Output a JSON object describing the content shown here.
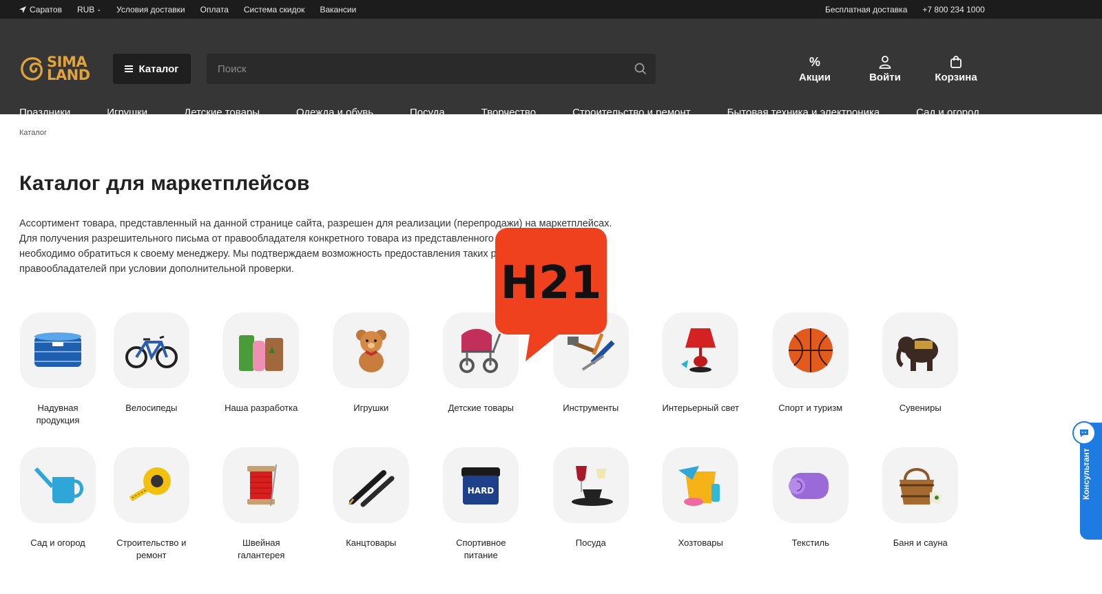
{
  "topbar": {
    "city": "Саратов",
    "currency": "RUB",
    "links": [
      "Условия доставки",
      "Оплата",
      "Система скидок",
      "Вакансии"
    ],
    "free_delivery": "Бесплатная доставка",
    "phone": "+7 800 234 1000"
  },
  "header": {
    "logo_line1": "SIMA",
    "logo_line2": "LAND",
    "catalog_button": "Каталог",
    "search_placeholder": "Поиск",
    "actions": {
      "promo": "Акции",
      "login": "Войти",
      "cart": "Корзина"
    }
  },
  "nav": [
    "Праздники",
    "Игрушки",
    "Детские товары",
    "Одежда и обувь",
    "Посуда",
    "Творчество",
    "Строительство и ремонт",
    "Бытовая техника и электроника",
    "Сад и огород"
  ],
  "breadcrumb": "Каталог",
  "title": "Каталог для маркетплейсов",
  "description": "Ассортимент товара, представленный на данной странице сайта, разрешен для реализации (перепродажи) на маркетплейсах. Для получения разрешительного письма от правообладателя конкретного товара из представленного ассортимента, вам необходимо обратиться к своему менеджеру. Мы подтверждаем возможность предоставления таких разрешений от правообладателей при условии дополнительной проверки.",
  "categories_row1": [
    {
      "name": "Надувная продукция",
      "icon": "pool-icon"
    },
    {
      "name": "Велосипеды",
      "icon": "bicycle-icon"
    },
    {
      "name": "Наша разработка",
      "icon": "products-icon"
    },
    {
      "name": "Игрушки",
      "icon": "teddy-bear-icon"
    },
    {
      "name": "Детские товары",
      "icon": "stroller-icon"
    },
    {
      "name": "Инструменты",
      "icon": "tools-icon"
    },
    {
      "name": "Интерьерный свет",
      "icon": "lamp-icon"
    },
    {
      "name": "Спорт и туризм",
      "icon": "basketball-icon"
    },
    {
      "name": "Сувениры",
      "icon": "elephant-icon"
    }
  ],
  "categories_row2": [
    {
      "name": "Сад и огород",
      "icon": "watering-can-icon"
    },
    {
      "name": "Строительство и ремонт",
      "icon": "tape-measure-icon"
    },
    {
      "name": "Швейная галантерея",
      "icon": "thread-spool-icon"
    },
    {
      "name": "Канцтовары",
      "icon": "pen-icon"
    },
    {
      "name": "Спортивное питание",
      "icon": "protein-jar-icon"
    },
    {
      "name": "Посуда",
      "icon": "dishes-icon"
    },
    {
      "name": "Хозтовары",
      "icon": "bucket-icon"
    },
    {
      "name": "Текстиль",
      "icon": "towel-icon"
    },
    {
      "name": "Баня и сауна",
      "icon": "sauna-bucket-icon"
    }
  ],
  "overlay_badge": "H21",
  "consultant_tab": "Консультант",
  "colors": {
    "topbar": "#1c1c1c",
    "header": "#363636",
    "brand_gold": "#e2a33a",
    "badge_red": "#f0411f",
    "consult_blue": "#1e7be2"
  }
}
